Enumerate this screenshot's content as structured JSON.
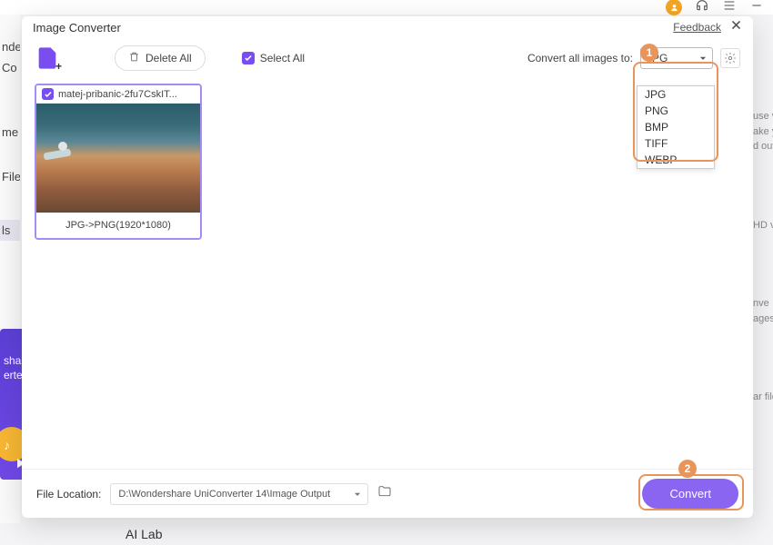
{
  "bg": {
    "sidebar_items": [
      "nde",
      "Co",
      "me",
      "File",
      "ls"
    ],
    "promo_line1": "sha",
    "promo_line2": "erte",
    "right_frags": [
      "use v",
      "ake y",
      "d out",
      "HD v",
      "nve",
      "ages",
      "ar file"
    ],
    "bottom_label": "AI Lab"
  },
  "modal": {
    "title": "Image Converter",
    "feedback": "Feedback"
  },
  "toolbar": {
    "delete_label": "Delete All",
    "select_all_label": "Select All",
    "convert_to_label": "Convert all images to:",
    "selected_format": "JPG"
  },
  "dropdown_options": [
    "JPG",
    "PNG",
    "BMP",
    "TIFF",
    "WEBP"
  ],
  "callouts": {
    "one": "1",
    "two": "2"
  },
  "thumb": {
    "filename": "matej-pribanic-2fu7CskIT...",
    "conversion": "JPG->PNG(1920*1080)"
  },
  "footer": {
    "loc_label": "File Location:",
    "loc_path": "D:\\Wondershare UniConverter 14\\Image Output",
    "convert_label": "Convert"
  }
}
